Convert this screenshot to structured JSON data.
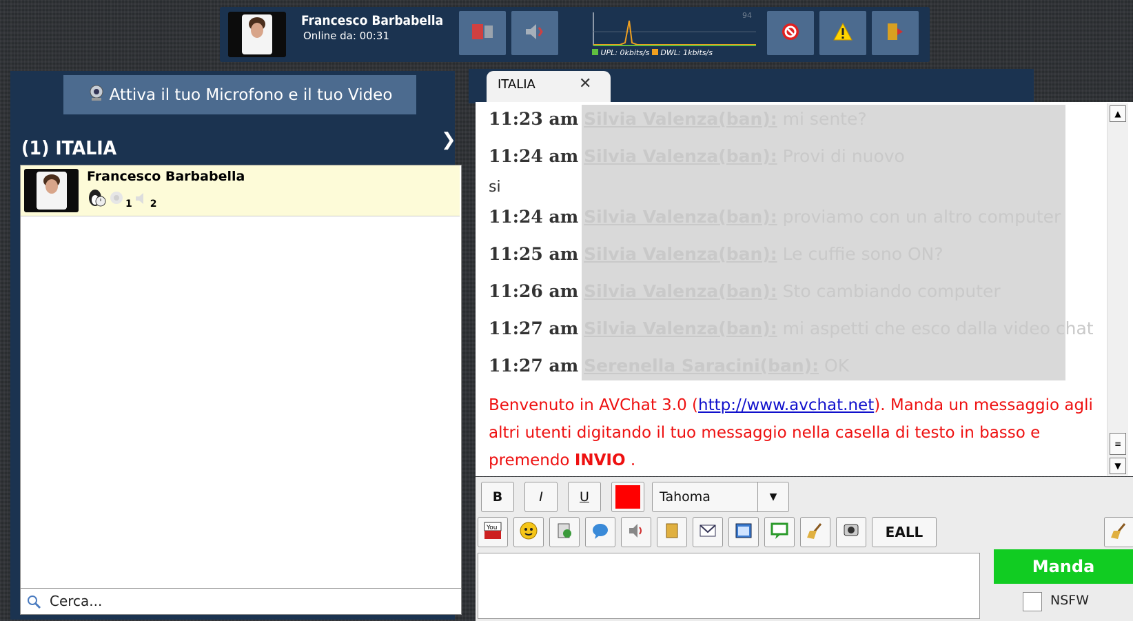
{
  "topbar": {
    "user_name": "Francesco Barbabella",
    "online_label": "Online da: 00:31",
    "graph_peak": "94",
    "upload_label": "UPL: 0kbits/s",
    "download_label": "DWL: 1kbits/s"
  },
  "left_panel": {
    "mic_button_label": "Attiva il tuo Microfono e il tuo Video",
    "room_title": "(1) ITALIA",
    "user": {
      "name": "Francesco Barbabella",
      "badge_1": "1",
      "badge_2": "2"
    },
    "search_placeholder": "Cerca..."
  },
  "chat": {
    "tab_label": "ITALIA",
    "messages": [
      {
        "time": "11:23 am",
        "user": "Silvia Valenza(ban):",
        "text": "mi sente?"
      },
      {
        "time": "11:24 am",
        "user": "Silvia Valenza(ban):",
        "text": "Provi di nuovo"
      },
      {
        "time": "11:24 am",
        "user": "Silvia Valenza(ban):",
        "text": "proviamo con un altro computer"
      },
      {
        "time": "11:25 am",
        "user": "Silvia Valenza(ban):",
        "text": "Le cuffie sono ON?"
      },
      {
        "time": "11:26 am",
        "user": "Silvia Valenza(ban):",
        "text": "Sto cambiando computer"
      },
      {
        "time": "11:27 am",
        "user": "Silvia Valenza(ban):",
        "text": "mi aspetti che esco dalla video chat"
      },
      {
        "time": "11:27 am",
        "user": "Serenella Saracini(ban):",
        "text": "OK"
      }
    ],
    "plain_line": "si",
    "welcome": {
      "before": "Benvenuto in AVChat 3.0 (",
      "link": "http://www.avchat.net",
      "after": "). Manda un messaggio agli altri utenti digitando il tuo messaggio nella casella di testo in basso e premendo ",
      "bold": "INVIO",
      "end": " ."
    }
  },
  "toolbar": {
    "bold": "B",
    "italic": "I",
    "underline": "U",
    "text_color": "#ff0000",
    "font_name": "Tahoma",
    "eall_label": "EALL",
    "send_label": "Manda",
    "nsfw_label": "NSFW"
  },
  "colors": {
    "panel": "#1b3350",
    "button": "#4c6b8f",
    "send": "#11cc22",
    "welcome_text": "#ee1111"
  }
}
